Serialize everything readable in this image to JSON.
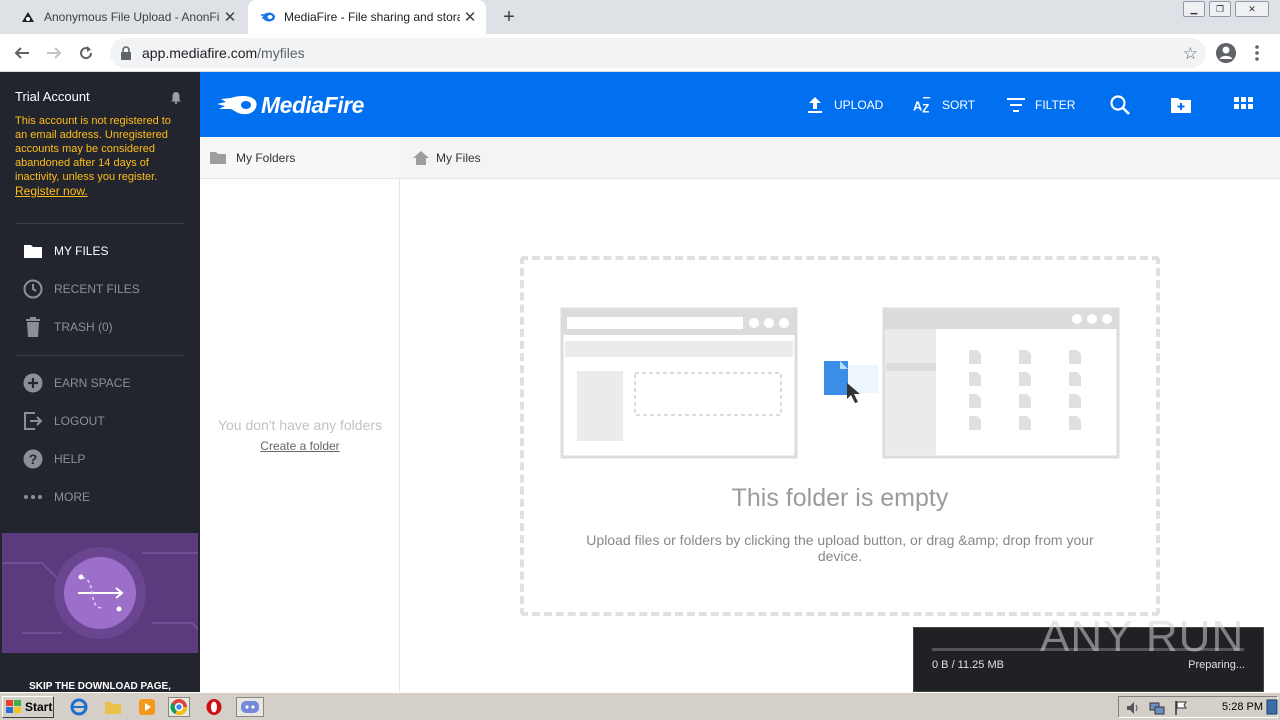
{
  "browser": {
    "tabs": [
      {
        "title": "Anonymous File Upload - AnonFiles",
        "close": "✕"
      },
      {
        "title": "MediaFire - File sharing and storage",
        "close": "✕"
      }
    ],
    "new_tab": "+",
    "url_host": "app.mediafire.com",
    "url_path": "/myfiles"
  },
  "sidebar": {
    "account_title": "Trial Account",
    "account_message": "This account is not registered to an email address. Unregistered accounts may be considered abandoned after 14 days of inactivity, unless you register.",
    "register_link": "Register now.",
    "nav": [
      {
        "label": "MY FILES",
        "icon": "folder-icon",
        "active": true
      },
      {
        "label": "RECENT FILES",
        "icon": "clock-icon"
      },
      {
        "label": "TRASH (0)",
        "icon": "trash-icon"
      },
      {
        "label": "EARN SPACE",
        "icon": "plus-circle-icon"
      },
      {
        "label": "LOGOUT",
        "icon": "logout-icon"
      },
      {
        "label": "HELP",
        "icon": "help-icon"
      },
      {
        "label": "MORE",
        "icon": "more-icon"
      }
    ],
    "promo_text": "SKIP THE DOWNLOAD PAGE,"
  },
  "header": {
    "logo": "MediaFire",
    "upload": "UPLOAD",
    "sort": "SORT",
    "filter": "FILTER"
  },
  "folders": {
    "title": "My Folders",
    "empty": "You don't have any folders",
    "create": "Create a folder"
  },
  "main": {
    "breadcrumb": "My Files",
    "empty_title": "This folder is empty",
    "empty_subtitle": "Upload files or folders by clicking the upload button, or drag &amp; drop from your device."
  },
  "download": {
    "size": "0 B / 11.25 MB",
    "status": "Preparing..."
  },
  "watermark": "ANY RUN",
  "taskbar": {
    "start": "Start",
    "time": "5:28 PM"
  },
  "colors": {
    "mf_blue": "#0070f0",
    "sidebar_bg": "#23252e",
    "warning": "#ffbd18"
  }
}
